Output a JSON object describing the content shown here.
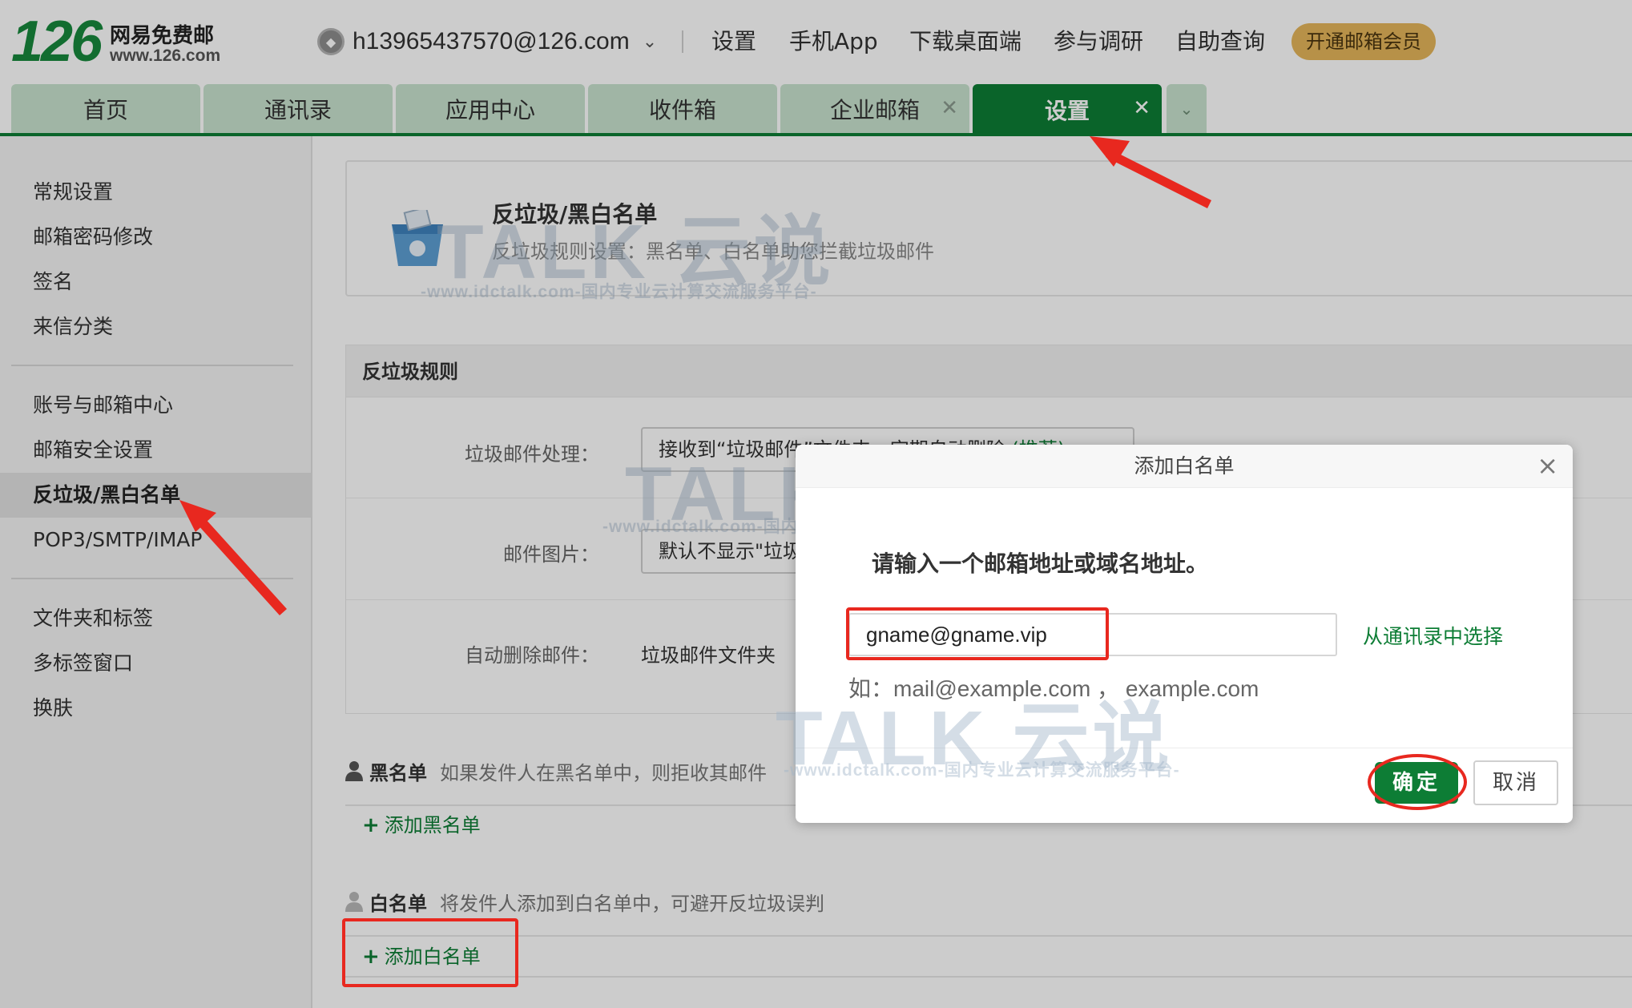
{
  "header": {
    "logo_number": "126",
    "logo_name": "网易免费邮",
    "logo_url": "www.126.com",
    "account_email": "h13965437570@126.com",
    "nav_links": [
      "设置",
      "手机App",
      "下载桌面端",
      "参与调研",
      "自助查询"
    ],
    "vip_button": "开通邮箱会员"
  },
  "tabs": [
    {
      "label": "首页",
      "closable": false,
      "active": false
    },
    {
      "label": "通讯录",
      "closable": false,
      "active": false
    },
    {
      "label": "应用中心",
      "closable": false,
      "active": false
    },
    {
      "label": "收件箱",
      "closable": false,
      "active": false
    },
    {
      "label": "企业邮箱",
      "closable": true,
      "active": false
    },
    {
      "label": "设置",
      "closable": true,
      "active": true
    }
  ],
  "sidebar": {
    "groups": [
      [
        "常规设置",
        "邮箱密码修改",
        "签名",
        "来信分类"
      ],
      [
        "账号与邮箱中心",
        "邮箱安全设置",
        "反垃圾/黑白名单",
        "POP3/SMTP/IMAP"
      ],
      [
        "文件夹和标签",
        "多标签窗口",
        "换肤"
      ]
    ],
    "active_item": "反垃圾/黑白名单"
  },
  "hero": {
    "title": "反垃圾/黑白名单",
    "desc": "反垃圾规则设置：黑名单、白名单助您拦截垃圾邮件"
  },
  "rules": {
    "heading": "反垃圾规则",
    "spam_label": "垃圾邮件处理：",
    "spam_value": "接收到“垃圾邮件”文件夹，定期自动删除",
    "spam_more": "(推荐)",
    "image_label": "邮件图片：",
    "image_value": "默认不显示\"垃圾邮件\"中的图片",
    "auto_delete_label": "自动删除邮件：",
    "auto_delete_value": "垃圾邮件文件夹"
  },
  "blacklist": {
    "title": "黑名单",
    "desc": "如果发件人在黑名单中，则拒收其邮件",
    "add_label": "添加黑名单"
  },
  "whitelist": {
    "title": "白名单",
    "desc": "将发件人添加到白名单中，可避开反垃圾误判",
    "add_label": "添加白名单"
  },
  "dialog": {
    "title": "添加白名单",
    "prompt": "请输入一个邮箱地址或域名地址。",
    "input_value": "gname@gname.vip",
    "from_contacts": "从通讯录中选择",
    "hint": "如：mail@example.com ， example.com",
    "ok": "确定",
    "cancel": "取消"
  },
  "watermark": {
    "brand": "TALK 云说",
    "url": "-www.idctalk.com-国内专业云计算交流服务平台-"
  },
  "colors": {
    "brand_green": "#0d7d35",
    "tab_inactive": "#c9e3cf",
    "vip_gold": "#e5b65a",
    "annotation_red": "#e8281f"
  }
}
